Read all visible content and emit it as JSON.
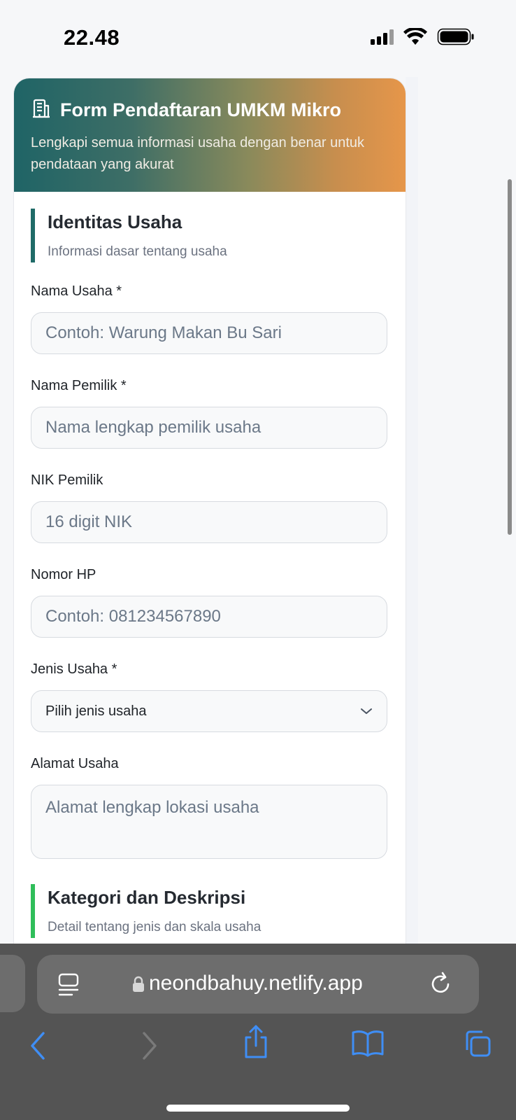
{
  "status": {
    "time": "22.48"
  },
  "form": {
    "title": "Form Pendaftaran UMKM Mikro",
    "subtitle": "Lengkapi semua informasi usaha dengan benar untuk pendataan yang akurat",
    "sections": [
      {
        "title": "Identitas Usaha",
        "subtitle": "Informasi dasar tentang usaha",
        "accent": "#1f6b68"
      },
      {
        "title": "Kategori dan Deskripsi",
        "subtitle": "Detail tentang jenis dan skala usaha",
        "accent": "#2fbe5a"
      }
    ],
    "fields": {
      "nama_usaha": {
        "label": "Nama Usaha *",
        "placeholder": "Contoh: Warung Makan Bu Sari",
        "value": ""
      },
      "nama_pemilik": {
        "label": "Nama Pemilik *",
        "placeholder": "Nama lengkap pemilik usaha",
        "value": ""
      },
      "nik_pemilik": {
        "label": "NIK Pemilik",
        "placeholder": "16 digit NIK",
        "value": ""
      },
      "nomor_hp": {
        "label": "Nomor HP",
        "placeholder": "Contoh: 081234567890",
        "value": ""
      },
      "jenis_usaha": {
        "label": "Jenis Usaha *",
        "selected": "Pilih jenis usaha"
      },
      "alamat_usaha": {
        "label": "Alamat Usaha",
        "placeholder": "Alamat lengkap lokasi usaha",
        "value": ""
      }
    },
    "header_gradient": [
      "#1f6466",
      "#e6964a"
    ]
  },
  "browser": {
    "url": "neondbahuy.netlify.app",
    "icons": [
      "reader-icon",
      "lock-icon",
      "reload-icon",
      "back-icon",
      "forward-icon",
      "share-icon",
      "bookmarks-icon",
      "tabs-icon"
    ]
  }
}
